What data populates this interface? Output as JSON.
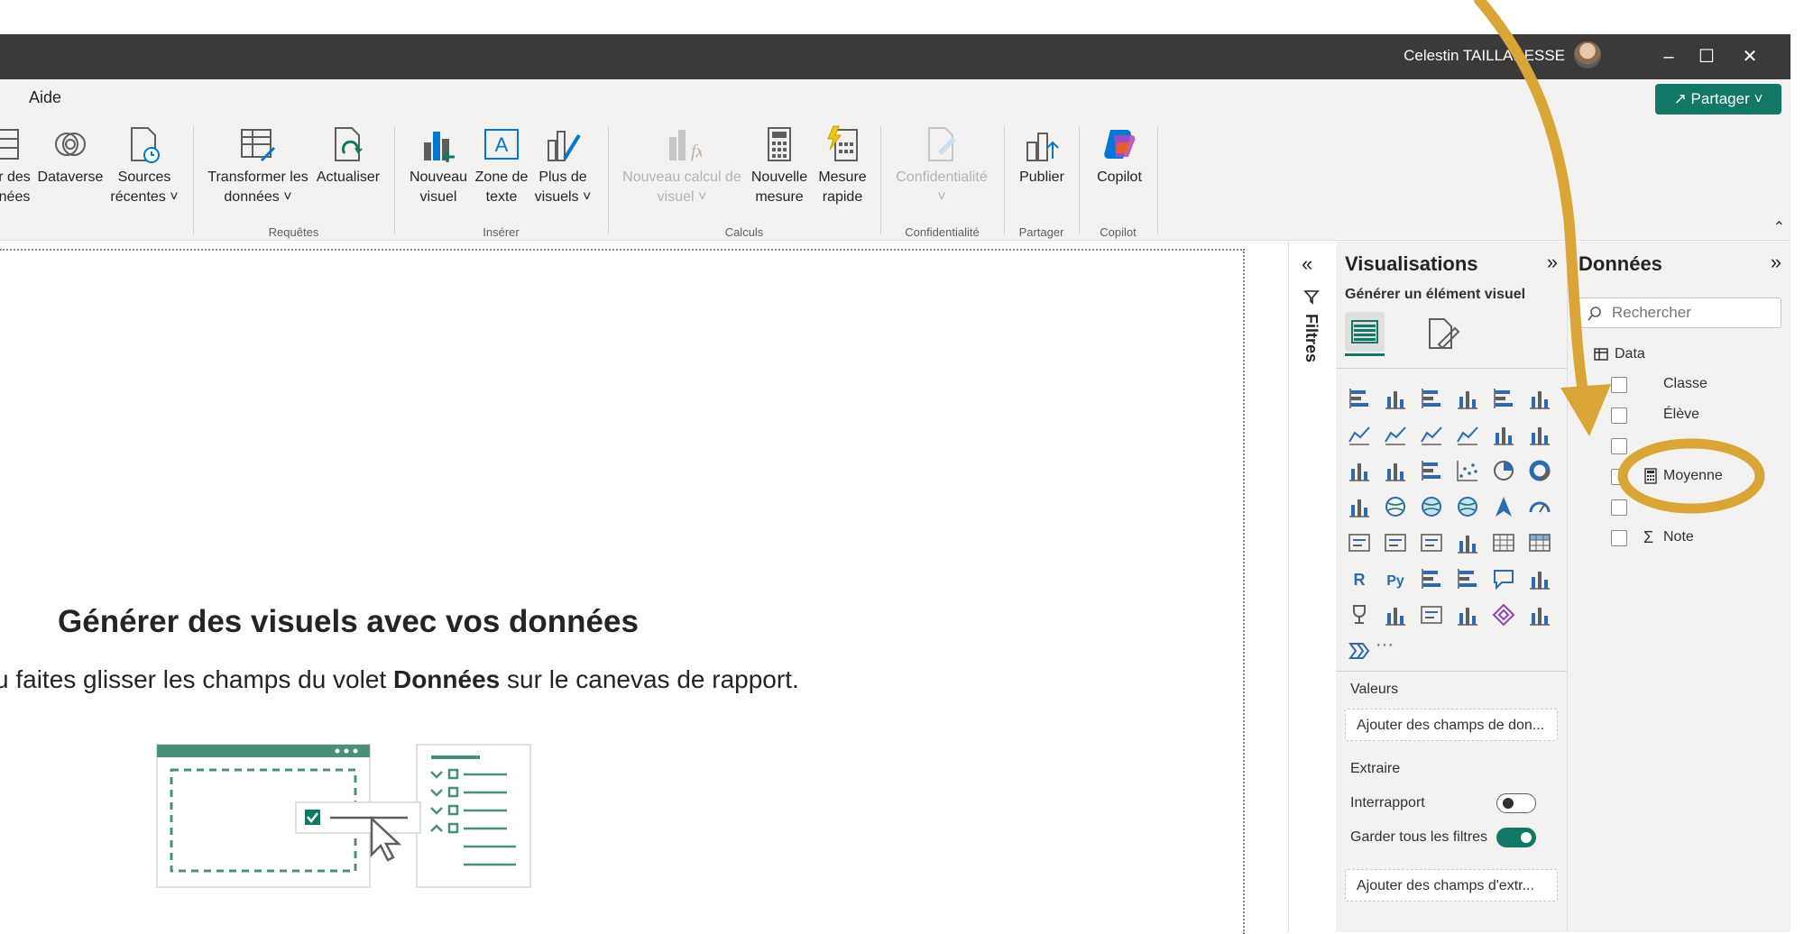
{
  "titlebar": {
    "user": "Celestin TAILLADESSE"
  },
  "menu": {
    "tab": "Aide",
    "share": "Partager"
  },
  "ribbon": {
    "buttons": [
      {
        "label1": "r des",
        "label2": "nées"
      },
      {
        "label1": "Dataverse",
        "label2": ""
      },
      {
        "label1": "Sources",
        "label2": "récentes ˅"
      },
      {
        "label1": "Transformer les",
        "label2": "données ˅"
      },
      {
        "label1": "Actualiser",
        "label2": ""
      },
      {
        "label1": "Nouveau",
        "label2": "visuel"
      },
      {
        "label1": "Zone de",
        "label2": "texte"
      },
      {
        "label1": "Plus de",
        "label2": "visuels ˅"
      },
      {
        "label1": "Nouveau calcul de",
        "label2": "visuel ˅"
      },
      {
        "label1": "Nouvelle",
        "label2": "mesure"
      },
      {
        "label1": "Mesure",
        "label2": "rapide"
      },
      {
        "label1": "Confidentialité",
        "label2": "˅"
      },
      {
        "label1": "Publier",
        "label2": ""
      },
      {
        "label1": "Copilot",
        "label2": ""
      }
    ],
    "groups": [
      "Requêtes",
      "Insérer",
      "Calculs",
      "Confidentialité",
      "Partager",
      "Copilot"
    ]
  },
  "canvas": {
    "title": "Générer des visuels avec vos données",
    "sub_pre": "u faites glisser les champs du volet ",
    "sub_bold": "Données",
    "sub_post": " sur le canevas de rapport."
  },
  "filters": {
    "label": "Filtres"
  },
  "viz": {
    "title": "Visualisations",
    "subtitle": "Générer un élément visuel",
    "more": "···",
    "values_label": "Valeurs",
    "values_well": "Ajouter des champs de don...",
    "extract_label": "Extraire",
    "interreport_label": "Interrapport",
    "interreport_on": false,
    "keepfilters_label": "Garder tous les filtres",
    "keepfilters_on": true,
    "extract_well": "Ajouter des champs d'extr..."
  },
  "data": {
    "title": "Données",
    "search_placeholder": "Rechercher",
    "table": "Data",
    "fields": [
      "Classe",
      "Élève",
      "",
      "Moyenne",
      "",
      "Note"
    ]
  },
  "colors": {
    "accent": "#117865",
    "arrow": "#d9a536",
    "titlebar": "#3b3a39"
  }
}
